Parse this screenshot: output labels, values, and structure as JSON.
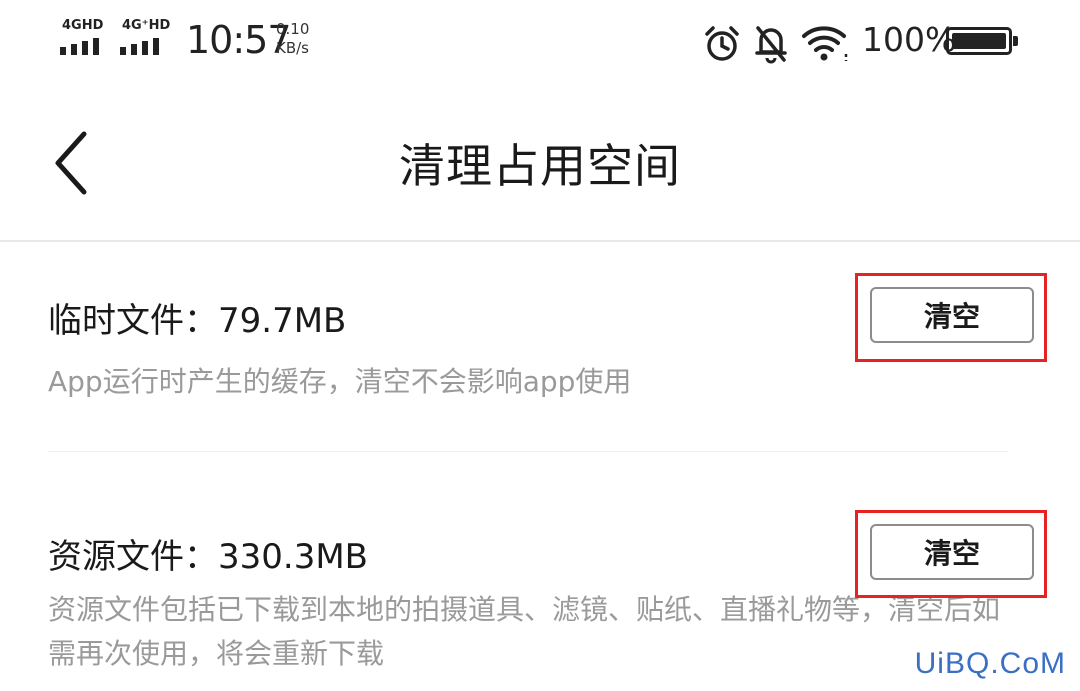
{
  "status_bar": {
    "sim1_network": "4GHD",
    "sim2_network": "4G⁺HD",
    "time": "10:57",
    "net_speed_value": "0.10",
    "net_speed_unit": "KB/s",
    "battery_percent": "100%",
    "icons": [
      "alarm-clock-icon",
      "bell-muted-icon",
      "wifi-icon",
      "battery-icon"
    ]
  },
  "nav": {
    "title": "清理占用空间",
    "back_icon": "chevron-left-icon"
  },
  "sections": [
    {
      "title": "临时文件：79.7MB",
      "description": "App运行时产生的缓存，清空不会影响app使用",
      "button_label": "清空"
    },
    {
      "title": "资源文件：330.3MB",
      "description": "资源文件包括已下载到本地的拍摄道具、滤镜、贴纸、直播礼物等，清空后如需再次使用，将会重新下载",
      "button_label": "清空"
    }
  ],
  "colors": {
    "highlight_box": "#e62222",
    "description_text": "#9a9a9a",
    "watermark": "#3a6fc4"
  },
  "watermark": "UiBQ.CoM"
}
